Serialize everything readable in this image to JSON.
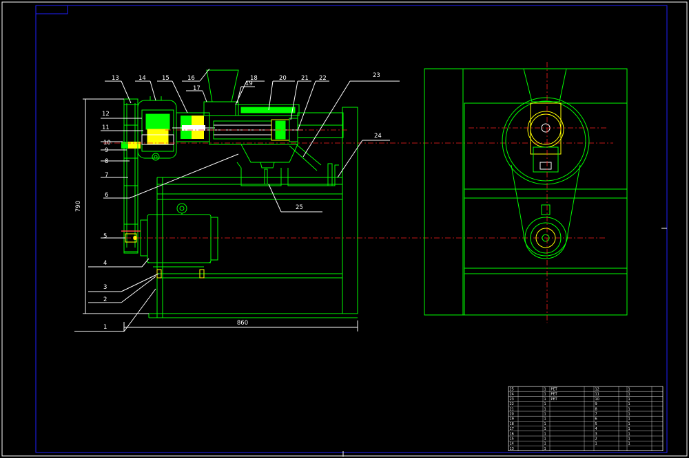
{
  "part_labels": [
    {
      "id": "13",
      "text": "13"
    },
    {
      "id": "14",
      "text": "14"
    },
    {
      "id": "15",
      "text": "15"
    },
    {
      "id": "16",
      "text": "16"
    },
    {
      "id": "17",
      "text": "17"
    },
    {
      "id": "18",
      "text": "18"
    },
    {
      "id": "19",
      "text": "19"
    },
    {
      "id": "20",
      "text": "20"
    },
    {
      "id": "21",
      "text": "21"
    },
    {
      "id": "22",
      "text": "22"
    },
    {
      "id": "23",
      "text": "23"
    },
    {
      "id": "24",
      "text": "24"
    },
    {
      "id": "25",
      "text": "25"
    },
    {
      "id": "12",
      "text": "12"
    },
    {
      "id": "11",
      "text": "11"
    },
    {
      "id": "10",
      "text": "10"
    },
    {
      "id": "9",
      "text": "9"
    },
    {
      "id": "8",
      "text": "8"
    },
    {
      "id": "7",
      "text": "7"
    },
    {
      "id": "6",
      "text": "6"
    },
    {
      "id": "5",
      "text": "5"
    },
    {
      "id": "4",
      "text": "4"
    },
    {
      "id": "3",
      "text": "3"
    },
    {
      "id": "2",
      "text": "2"
    },
    {
      "id": "1",
      "text": "1"
    }
  ],
  "dimensions": {
    "height": "790",
    "width": "860"
  },
  "title_block": {
    "rows": [
      [
        "25",
        "",
        "1",
        "PET",
        "",
        "12",
        "",
        "1",
        ""
      ],
      [
        "24",
        "",
        "1",
        "PET",
        "",
        "11",
        "",
        "1",
        ""
      ],
      [
        "23",
        "",
        "1",
        "PET",
        "",
        "10",
        "",
        "1",
        ""
      ],
      [
        "22",
        "",
        "1",
        "",
        "",
        "9",
        "",
        "1",
        ""
      ],
      [
        "21",
        "",
        "1",
        "",
        "",
        "8",
        "",
        "1",
        ""
      ],
      [
        "20",
        "",
        "1",
        "",
        "",
        "7",
        "",
        "1",
        ""
      ],
      [
        "19",
        "",
        "1",
        "",
        "",
        "6",
        "",
        "1",
        ""
      ],
      [
        "18",
        "",
        "1",
        "",
        "",
        "5",
        "",
        "1",
        ""
      ],
      [
        "17",
        "",
        "1",
        "",
        "",
        "4",
        "",
        "1",
        ""
      ],
      [
        "16",
        "",
        "1",
        "",
        "",
        "3",
        "",
        "1",
        ""
      ],
      [
        "15",
        "",
        "1",
        "",
        "",
        "2",
        "",
        "1",
        ""
      ],
      [
        "14",
        "",
        "1",
        "",
        "",
        "1",
        "",
        "1",
        ""
      ],
      [
        "13",
        "",
        "1",
        "",
        "",
        "",
        "",
        "",
        ""
      ]
    ]
  }
}
